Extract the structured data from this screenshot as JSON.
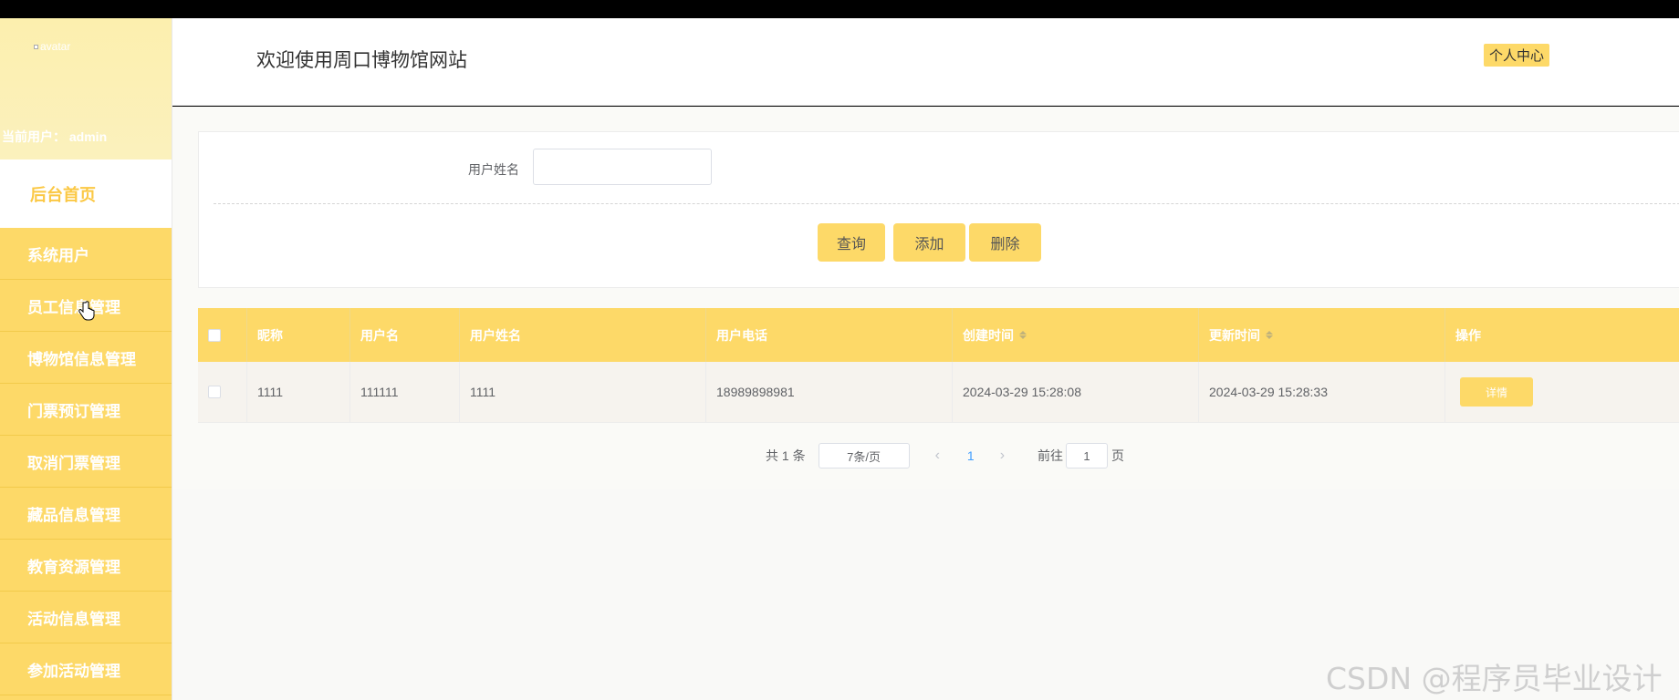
{
  "sidebar": {
    "avatar_alt": "avatar",
    "current_user": "当前用户： admin",
    "home": "后台首页",
    "items": [
      {
        "label": "系统用户"
      },
      {
        "label": "员工信息管理"
      },
      {
        "label": "博物馆信息管理"
      },
      {
        "label": "门票预订管理"
      },
      {
        "label": "取消门票管理"
      },
      {
        "label": "藏品信息管理"
      },
      {
        "label": "教育资源管理"
      },
      {
        "label": "活动信息管理"
      },
      {
        "label": "参加活动管理"
      }
    ]
  },
  "header": {
    "title": "欢迎使用周口博物馆网站",
    "profile": "个人中心"
  },
  "search": {
    "label": "用户姓名",
    "value": "",
    "buttons": {
      "query": "查询",
      "add": "添加",
      "delete": "删除"
    }
  },
  "table": {
    "columns": [
      "昵称",
      "用户名",
      "用户姓名",
      "用户电话",
      "创建时间",
      "更新时间",
      "操作"
    ],
    "rows": [
      {
        "nickname": "1111",
        "username": "111111",
        "realname": "1111",
        "phone": "18989898981",
        "created": "2024-03-29 15:28:08",
        "updated": "2024-03-29 15:28:33",
        "action": "详情"
      }
    ]
  },
  "pagination": {
    "total_text": "共 1 条",
    "page_size": "7条/页",
    "prev": "‹",
    "current_page": "1",
    "next": "›",
    "goto_label": "前往",
    "goto_value": "1",
    "page_suffix": "页"
  },
  "watermark": "CSDN @程序员毕业设计",
  "colors": {
    "accent": "#fdd968",
    "sidebar_header": "#fcefae",
    "link": "#409eff"
  }
}
